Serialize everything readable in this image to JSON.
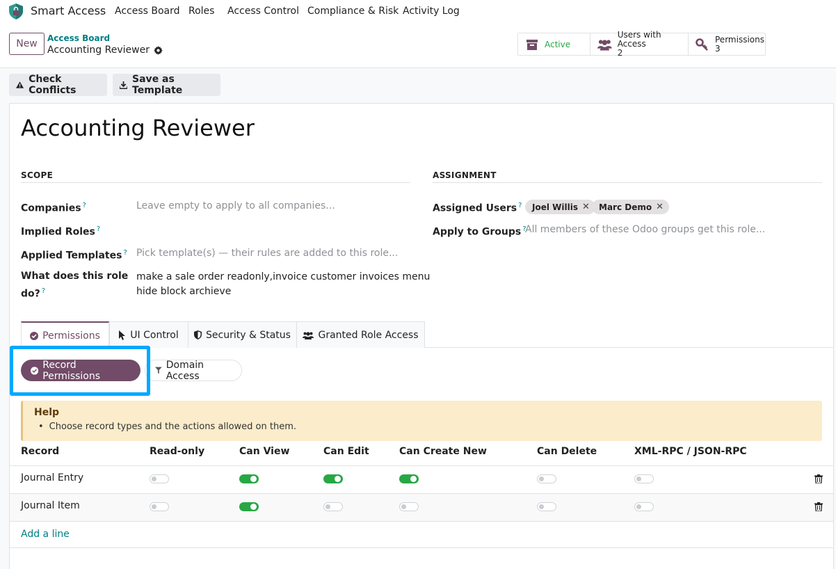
{
  "nav": {
    "app_name": "Smart Access",
    "items": [
      "Access Board",
      "Roles",
      "Access Control",
      "Compliance & Risk",
      "Activity Log"
    ]
  },
  "control_panel": {
    "new_label": "New",
    "breadcrumb_parent": "Access Board",
    "breadcrumb_current": "Accounting Reviewer",
    "smart_buttons": {
      "active_label": "Active",
      "users_label": "Users with Access",
      "users_count": "2",
      "permissions_label": "Permissions",
      "permissions_count": "3"
    }
  },
  "actions": {
    "check_conflicts": "Check Conflicts",
    "save_template": "Save as Template"
  },
  "form": {
    "title": "Accounting Reviewer",
    "scope": {
      "heading": "SCOPE",
      "companies_label": "Companies",
      "companies_placeholder": "Leave empty to apply to all companies...",
      "implied_roles_label": "Implied Roles",
      "applied_templates_label": "Applied Templates",
      "applied_templates_placeholder": "Pick template(s) — their rules are added to this role...",
      "description_label_1": "What does this role",
      "description_label_2": "do?",
      "description_line_1": "make a sale order readonly,invoice customer invoices menu",
      "description_line_2": "hide block archieve",
      "help_mark": "?"
    },
    "assignment": {
      "heading": "ASSIGNMENT",
      "assigned_users_label": "Assigned Users",
      "users": [
        "Joel Willis",
        "Marc Demo"
      ],
      "groups_label": "Apply to Groups",
      "groups_placeholder": "All members of these Odoo groups get this role..."
    }
  },
  "tabs": [
    "Permissions",
    "UI Control",
    "Security & Status",
    "Granted Role Access"
  ],
  "subtabs": [
    "Record Permissions",
    "Domain Access"
  ],
  "help_box": {
    "title": "Help",
    "item": "Choose record types and the actions allowed on them."
  },
  "table": {
    "columns": [
      "Record",
      "Read-only",
      "Can View",
      "Can Edit",
      "Can Create New",
      "Can Delete",
      "XML-RPC / JSON-RPC"
    ],
    "rows": [
      {
        "record": "Journal Entry",
        "values": [
          false,
          true,
          true,
          true,
          false,
          false
        ]
      },
      {
        "record": "Journal Item",
        "values": [
          false,
          true,
          false,
          false,
          false,
          false
        ]
      }
    ],
    "add_line": "Add a line"
  },
  "colors": {
    "brand": "#714b67",
    "teal": "#017e84",
    "toggle_on": "#28a745",
    "highlight": "#00a8ff"
  }
}
